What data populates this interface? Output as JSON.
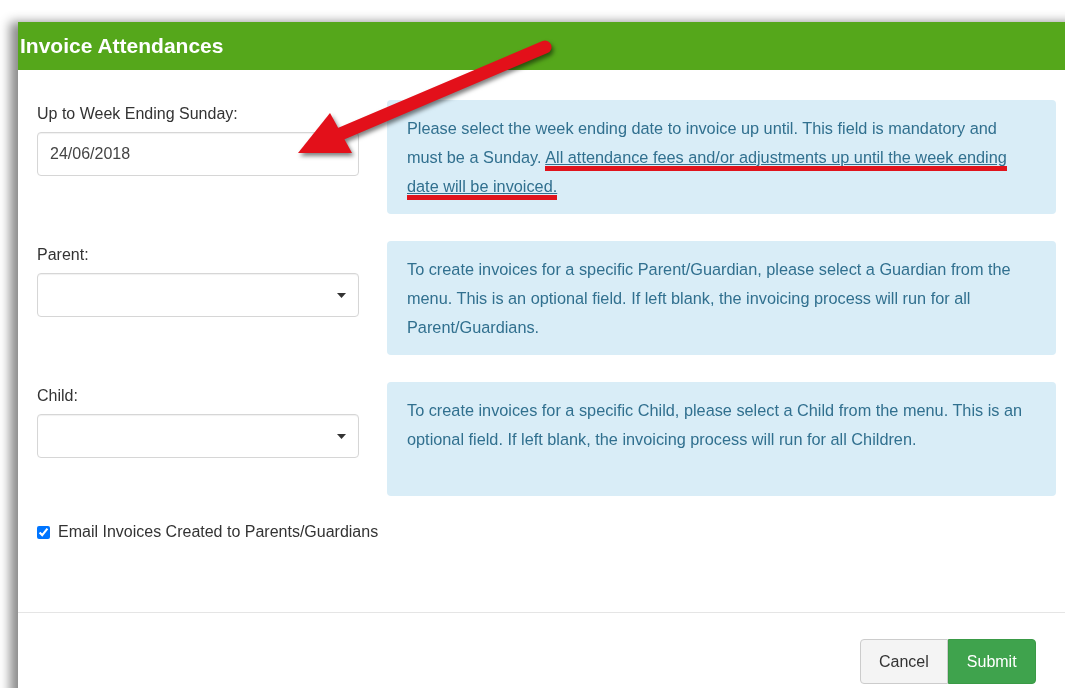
{
  "dialog": {
    "title": "Invoice Attendances"
  },
  "fields": [
    {
      "kind": "date",
      "label": "Up to Week Ending Sunday:",
      "value": "24/06/2018",
      "help": "Please select the week ending date to invoice up until. This field is mandatory and must be a Sunday. ",
      "help_highlight": "All attendance fees and/or adjustments up until the week ending date will be invoiced."
    },
    {
      "kind": "select",
      "label": "Parent:",
      "help": "To create invoices for a specific Parent/Guardian, please select a Guardian from the menu. This is an optional field. If left blank, the invoicing process will run for all Parent/Guardians."
    },
    {
      "kind": "select",
      "label": "Child:",
      "help": "To create invoices for a specific Child, please select a Child from the menu. This is an optional field. If left blank, the invoicing process will run for all Children."
    }
  ],
  "checkbox": {
    "label": "Email Invoices Created to Parents/Guardians",
    "checked": true
  },
  "buttons": [
    {
      "label": "Cancel",
      "kind": "default"
    },
    {
      "label": "Submit",
      "kind": "primary"
    }
  ]
}
